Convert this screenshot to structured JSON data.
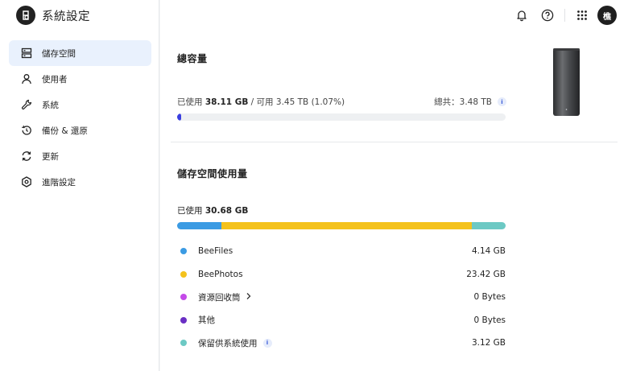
{
  "app": {
    "title": "系統設定",
    "avatar_initial": "樵"
  },
  "sidebar": {
    "items": [
      {
        "label": "儲存空間",
        "icon": "storage-icon",
        "active": true
      },
      {
        "label": "使用者",
        "icon": "user-icon",
        "active": false
      },
      {
        "label": "系統",
        "icon": "wrench-icon",
        "active": false
      },
      {
        "label": "備份 & 還原",
        "icon": "history-icon",
        "active": false
      },
      {
        "label": "更新",
        "icon": "refresh-icon",
        "active": false
      },
      {
        "label": "進階設定",
        "icon": "hexagon-gear-icon",
        "active": false
      }
    ]
  },
  "header": {
    "icons": [
      "bell-icon",
      "help-icon",
      "apps-grid-icon"
    ]
  },
  "capacity": {
    "title": "總容量",
    "used_prefix": "已使用",
    "used_value": "38.11 GB",
    "available_text": " / 可用 3.45 TB (1.07%)",
    "total_text": "總共：3.48 TB",
    "used_fraction": 0.0107,
    "bar_color": "#3a3fe0"
  },
  "usage": {
    "title": "儲存空間使用量",
    "used_prefix": "已使用",
    "used_value": "30.68 GB",
    "items": [
      {
        "name": "BeeFiles",
        "value": "4.14 GB",
        "color": "#3b9be3",
        "gb": 4.14,
        "chevron": false,
        "info": false
      },
      {
        "name": "BeePhotos",
        "value": "23.42 GB",
        "color": "#f4c21c",
        "gb": 23.42,
        "chevron": false,
        "info": false
      },
      {
        "name": "資源回收筒",
        "value": "0 Bytes",
        "color": "#c44ae8",
        "gb": 0,
        "chevron": true,
        "info": false
      },
      {
        "name": "其他",
        "value": "0 Bytes",
        "color": "#6a2fc4",
        "gb": 0,
        "chevron": false,
        "info": false
      },
      {
        "name": "保留供系統使用",
        "value": "3.12 GB",
        "color": "#6cc9c4",
        "gb": 3.12,
        "chevron": false,
        "info": true
      }
    ]
  }
}
